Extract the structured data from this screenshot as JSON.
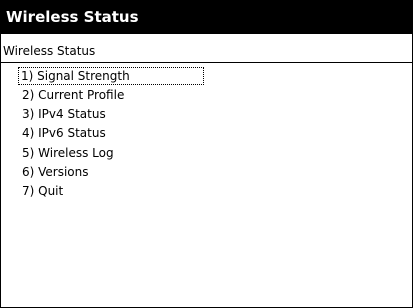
{
  "window": {
    "title": "Wireless Status"
  },
  "header": {
    "subtitle": "Wireless Status"
  },
  "menu": {
    "items": [
      {
        "label": "1) Signal Strength",
        "focused": true
      },
      {
        "label": "2) Current Profile"
      },
      {
        "label": "3) IPv4 Status"
      },
      {
        "label": "4) IPv6 Status"
      },
      {
        "label": "5) Wireless Log"
      },
      {
        "label": "6) Versions"
      },
      {
        "label": "7) Quit"
      }
    ]
  },
  "colors": {
    "titlebar_bg": "#000000",
    "titlebar_text": "#ffffff",
    "background": "#ffffff",
    "text": "#000000"
  }
}
